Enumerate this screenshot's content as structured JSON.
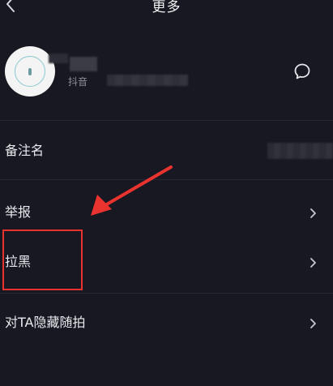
{
  "header": {
    "title": "更多"
  },
  "profile": {
    "id_prefix": "抖音"
  },
  "menu": {
    "remark": "备注名",
    "report": "举报",
    "block": "拉黑",
    "hide_from": "对TA隐藏随拍"
  },
  "colors": {
    "background": "#171821",
    "annotation_red": "#e8332f",
    "text": "#e9e9ee",
    "muted": "#8d8e96"
  },
  "icons": [
    "back-icon",
    "chat-icon",
    "chevron-right-icon"
  ]
}
